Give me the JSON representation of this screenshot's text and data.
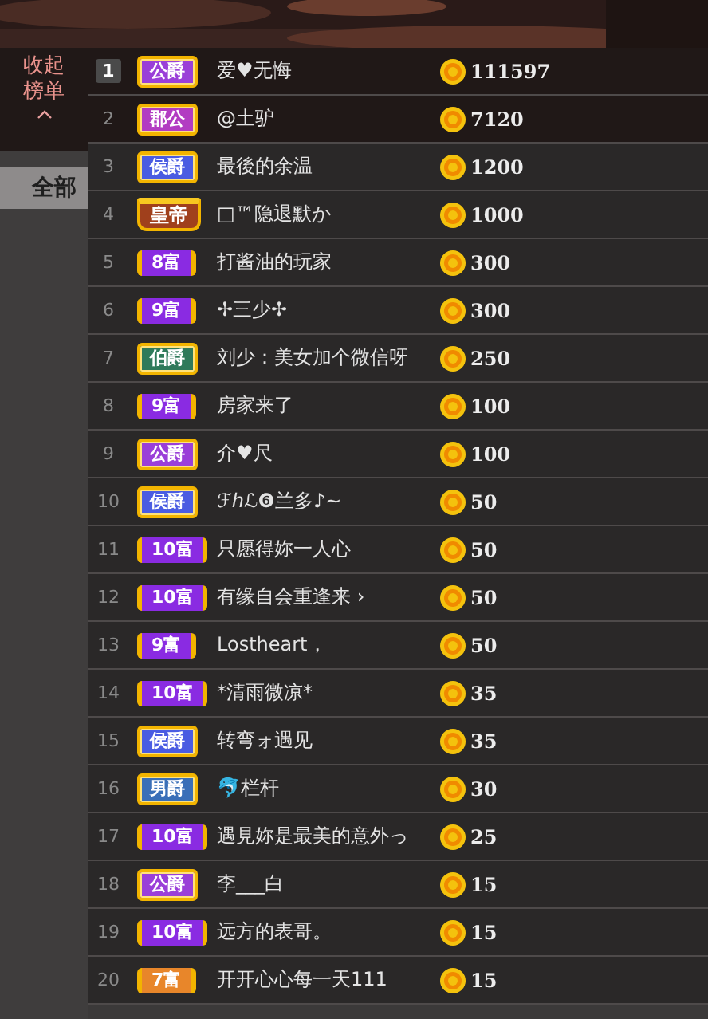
{
  "sidebar": {
    "collapse_label": "收起榜单"
  },
  "tabs": [
    {
      "label": "全部",
      "selected": true
    }
  ],
  "ranking": [
    {
      "rank": "1",
      "highlighted": true,
      "badge": {
        "kind": "noble",
        "label": "公爵",
        "color": "#9a3fd8"
      },
      "name": "爱♥无悔",
      "coins": "111597"
    },
    {
      "rank": "2",
      "highlighted": false,
      "badge": {
        "kind": "noble",
        "label": "郡公",
        "color": "#b23cc2"
      },
      "name": "@土驴",
      "coins": "7120"
    },
    {
      "rank": "3",
      "highlighted": false,
      "badge": {
        "kind": "noble",
        "label": "侯爵",
        "color": "#4a5ce2"
      },
      "name": "最後的余温",
      "coins": "1200"
    },
    {
      "rank": "4",
      "highlighted": false,
      "badge": {
        "kind": "emperor",
        "label": "皇帝",
        "color": "#a0401c"
      },
      "name": "□™隐退默か",
      "coins": "1000"
    },
    {
      "rank": "5",
      "highlighted": false,
      "badge": {
        "kind": "wealth",
        "label": "8富",
        "color": "#8a2be2"
      },
      "name": "打酱油的玩家",
      "coins": "300"
    },
    {
      "rank": "6",
      "highlighted": false,
      "badge": {
        "kind": "wealth",
        "label": "9富",
        "color": "#8a2be2"
      },
      "name": "✢三少✢",
      "coins": "300"
    },
    {
      "rank": "7",
      "highlighted": false,
      "badge": {
        "kind": "noble",
        "label": "伯爵",
        "color": "#2f7a5a"
      },
      "name": "刘少：美女加个微信呀",
      "coins": "250"
    },
    {
      "rank": "8",
      "highlighted": false,
      "badge": {
        "kind": "wealth",
        "label": "9富",
        "color": "#8a2be2"
      },
      "name": "房家来了",
      "coins": "100"
    },
    {
      "rank": "9",
      "highlighted": false,
      "badge": {
        "kind": "noble",
        "label": "公爵",
        "color": "#9a3fd8"
      },
      "name": "介♥尺",
      "coins": "100"
    },
    {
      "rank": "10",
      "highlighted": false,
      "badge": {
        "kind": "noble",
        "label": "侯爵",
        "color": "#4a5ce2"
      },
      "name": "ℱℎℒ❻兰多♪~",
      "coins": "50"
    },
    {
      "rank": "11",
      "highlighted": false,
      "badge": {
        "kind": "wealth",
        "label": "10富",
        "color": "#8a2be2"
      },
      "name": "只愿得妳一人心",
      "coins": "50"
    },
    {
      "rank": "12",
      "highlighted": false,
      "badge": {
        "kind": "wealth",
        "label": "10富",
        "color": "#8a2be2"
      },
      "name": "有缘自会重逢来 ›",
      "coins": "50"
    },
    {
      "rank": "13",
      "highlighted": false,
      "badge": {
        "kind": "wealth",
        "label": "9富",
        "color": "#8a2be2"
      },
      "name": "Lostheart，",
      "coins": "50"
    },
    {
      "rank": "14",
      "highlighted": false,
      "badge": {
        "kind": "wealth",
        "label": "10富",
        "color": "#8a2be2"
      },
      "name": "*清雨微凉*",
      "coins": "35"
    },
    {
      "rank": "15",
      "highlighted": false,
      "badge": {
        "kind": "noble",
        "label": "侯爵",
        "color": "#4a5ce2"
      },
      "name": "转弯ォ遇见",
      "coins": "35"
    },
    {
      "rank": "16",
      "highlighted": false,
      "badge": {
        "kind": "noble",
        "label": "男爵",
        "color": "#3a6fb8"
      },
      "name": "🐬栏杆",
      "coins": "30"
    },
    {
      "rank": "17",
      "highlighted": false,
      "badge": {
        "kind": "wealth",
        "label": "10富",
        "color": "#8a2be2"
      },
      "name": "遇見妳是最美的意外っ",
      "coins": "25"
    },
    {
      "rank": "18",
      "highlighted": false,
      "badge": {
        "kind": "noble",
        "label": "公爵",
        "color": "#9a3fd8"
      },
      "name": "李___白",
      "coins": "15"
    },
    {
      "rank": "19",
      "highlighted": false,
      "badge": {
        "kind": "wealth",
        "label": "10富",
        "color": "#8a2be2"
      },
      "name": "远方的表哥。",
      "coins": "15"
    },
    {
      "rank": "20",
      "highlighted": false,
      "badge": {
        "kind": "wealth",
        "label": "7富",
        "color": "#e8862a"
      },
      "name": "开开心心每一天111",
      "coins": "15"
    }
  ]
}
